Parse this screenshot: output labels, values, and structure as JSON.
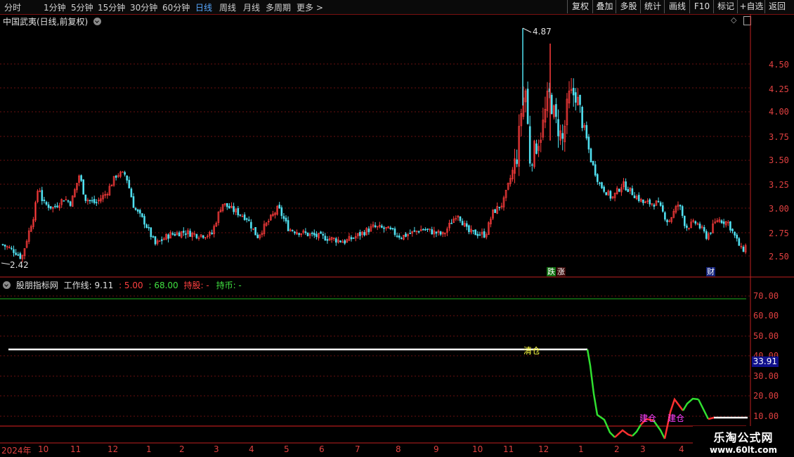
{
  "toolbar": {
    "timeframes": [
      "分时",
      "1分钟",
      "5分钟",
      "15分钟",
      "30分钟",
      "60分钟",
      "日线",
      "周线",
      "月线",
      "多周期",
      "更多 >"
    ],
    "active_timeframe": "日线",
    "right_buttons": [
      "复权",
      "叠加",
      "多股",
      "统计",
      "画线",
      "F10",
      "标记",
      "+自选",
      "返回"
    ]
  },
  "main_panel": {
    "title": "中国武夷(日线,前复权)",
    "price_labels": [
      "4.50",
      "4.25",
      "4.00",
      "3.75",
      "3.50",
      "3.25",
      "3.00",
      "2.75",
      "2.50"
    ],
    "high_marker": "4.87",
    "low_marker": "2.42",
    "tag_zhang": "涨",
    "tag_die": "跌",
    "tag_cai": "财",
    "colors": {
      "up": "#ff3c3c",
      "down": "#50e0f0",
      "axis": "#c02020"
    }
  },
  "indicator_panel": {
    "name": "股朋指标网",
    "work_line_label": "工作线: 9.11",
    "v1": ": 5.00",
    "v2": ": 68.00",
    "hold_stock": "持股: -",
    "hold_coin": "持币: -",
    "axis_labels": [
      "70.00",
      "60.00",
      "50.00",
      "40.00",
      "30.00",
      "20.00",
      "10.00"
    ],
    "current_value": "33.91",
    "signal_clear": "清仓",
    "signal_build_1": "建仓",
    "signal_build_2": "建仓"
  },
  "date_axis": {
    "year_label": "2024年",
    "months": [
      "10",
      "11",
      "12",
      "1",
      "2",
      "3",
      "4",
      "5",
      "6",
      "7",
      "8",
      "9",
      "10",
      "11",
      "12",
      "1",
      "2",
      "3",
      "4"
    ]
  },
  "watermark": {
    "line1": "乐淘公式网",
    "line2": "www.60lt.com"
  }
}
